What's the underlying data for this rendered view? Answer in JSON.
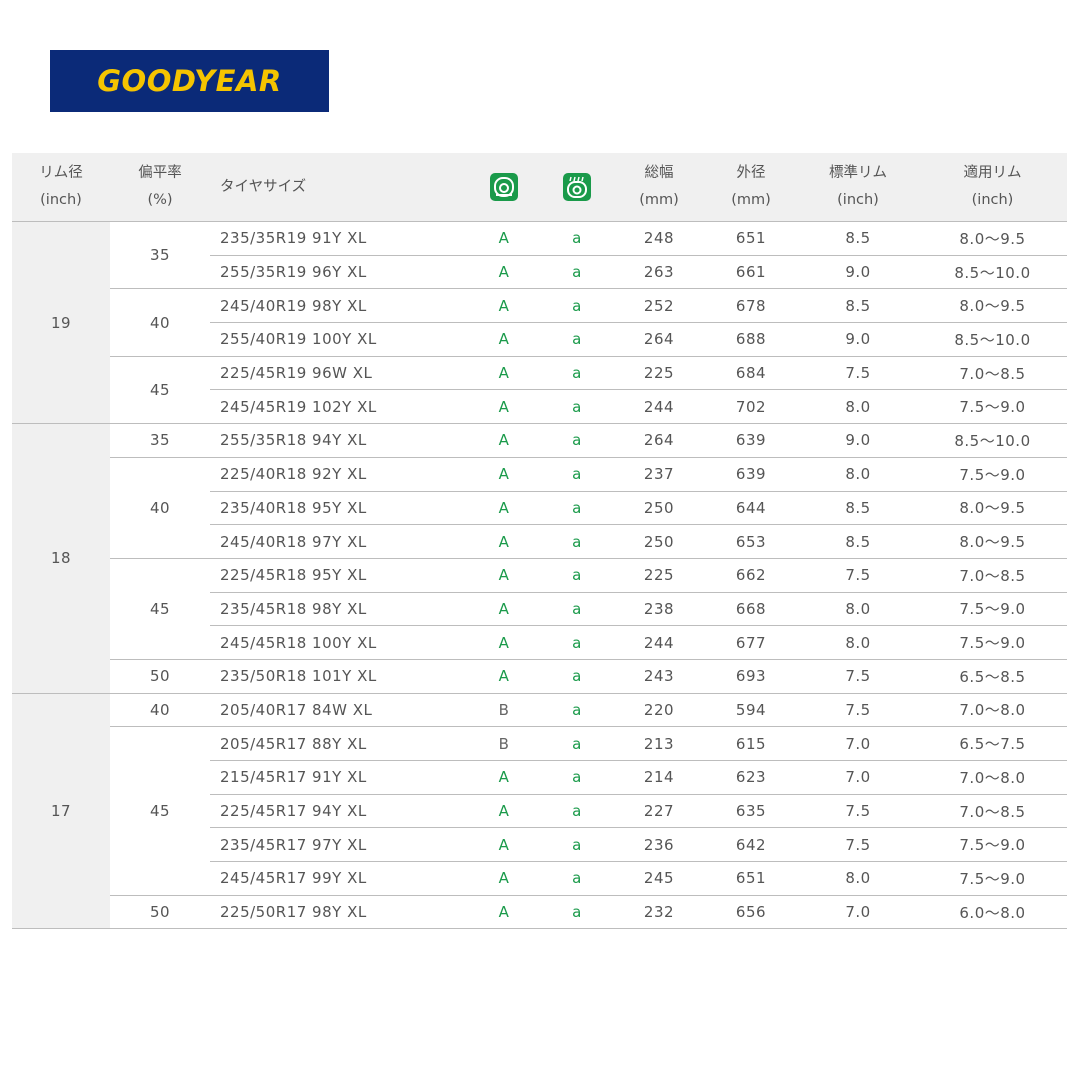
{
  "brand": {
    "logo_text": "GOODYEAR",
    "logo_bg": "#0b2a78",
    "logo_fg": "#f5c400"
  },
  "accent_green": "#1a9a4a",
  "header": {
    "rim_diameter": [
      "リム径",
      "(inch)"
    ],
    "aspect_ratio": [
      "偏平率",
      "(%)"
    ],
    "tire_size": "タイヤサイズ",
    "icon_rolling": "rolling-resistance-icon",
    "icon_wet": "wet-grip-icon",
    "width": [
      "総幅",
      "(mm)"
    ],
    "outer_diameter": [
      "外径",
      "(mm)"
    ],
    "standard_rim": [
      "標準リム",
      "(inch)"
    ],
    "applicable_rim": [
      "適用リム",
      "(inch)"
    ]
  },
  "groups": [
    {
      "rim": "19",
      "subgroups": [
        {
          "ratio": "35",
          "rows": [
            [
              "235/35R19 91Y XL",
              "A",
              "a",
              "248",
              "651",
              "8.5",
              "8.0〜9.5"
            ],
            [
              "255/35R19 96Y XL",
              "A",
              "a",
              "263",
              "661",
              "9.0",
              "8.5〜10.0"
            ]
          ]
        },
        {
          "ratio": "40",
          "rows": [
            [
              "245/40R19 98Y XL",
              "A",
              "a",
              "252",
              "678",
              "8.5",
              "8.0〜9.5"
            ],
            [
              "255/40R19 100Y XL",
              "A",
              "a",
              "264",
              "688",
              "9.0",
              "8.5〜10.0"
            ]
          ]
        },
        {
          "ratio": "45",
          "rows": [
            [
              "225/45R19 96W XL",
              "A",
              "a",
              "225",
              "684",
              "7.5",
              "7.0〜8.5"
            ],
            [
              "245/45R19 102Y XL",
              "A",
              "a",
              "244",
              "702",
              "8.0",
              "7.5〜9.0"
            ]
          ]
        }
      ]
    },
    {
      "rim": "18",
      "subgroups": [
        {
          "ratio": "35",
          "rows": [
            [
              "255/35R18 94Y XL",
              "A",
              "a",
              "264",
              "639",
              "9.0",
              "8.5〜10.0"
            ]
          ]
        },
        {
          "ratio": "40",
          "rows": [
            [
              "225/40R18 92Y XL",
              "A",
              "a",
              "237",
              "639",
              "8.0",
              "7.5〜9.0"
            ],
            [
              "235/40R18 95Y XL",
              "A",
              "a",
              "250",
              "644",
              "8.5",
              "8.0〜9.5"
            ],
            [
              "245/40R18 97Y XL",
              "A",
              "a",
              "250",
              "653",
              "8.5",
              "8.0〜9.5"
            ]
          ]
        },
        {
          "ratio": "45",
          "rows": [
            [
              "225/45R18 95Y XL",
              "A",
              "a",
              "225",
              "662",
              "7.5",
              "7.0〜8.5"
            ],
            [
              "235/45R18 98Y XL",
              "A",
              "a",
              "238",
              "668",
              "8.0",
              "7.5〜9.0"
            ],
            [
              "245/45R18 100Y XL",
              "A",
              "a",
              "244",
              "677",
              "8.0",
              "7.5〜9.0"
            ]
          ]
        },
        {
          "ratio": "50",
          "rows": [
            [
              "235/50R18 101Y XL",
              "A",
              "a",
              "243",
              "693",
              "7.5",
              "6.5〜8.5"
            ]
          ]
        }
      ]
    },
    {
      "rim": "17",
      "subgroups": [
        {
          "ratio": "40",
          "rows": [
            [
              "205/40R17 84W XL",
              "B",
              "a",
              "220",
              "594",
              "7.5",
              "7.0〜8.0"
            ]
          ]
        },
        {
          "ratio": "45",
          "rows": [
            [
              "205/45R17 88Y XL",
              "B",
              "a",
              "213",
              "615",
              "7.0",
              "6.5〜7.5"
            ],
            [
              "215/45R17 91Y XL",
              "A",
              "a",
              "214",
              "623",
              "7.0",
              "7.0〜8.0"
            ],
            [
              "225/45R17 94Y XL",
              "A",
              "a",
              "227",
              "635",
              "7.5",
              "7.0〜8.5"
            ],
            [
              "235/45R17 97Y XL",
              "A",
              "a",
              "236",
              "642",
              "7.5",
              "7.5〜9.0"
            ],
            [
              "245/45R17 99Y XL",
              "A",
              "a",
              "245",
              "651",
              "8.0",
              "7.5〜9.0"
            ]
          ]
        },
        {
          "ratio": "50",
          "rows": [
            [
              "225/50R17 98Y XL",
              "A",
              "a",
              "232",
              "656",
              "7.0",
              "6.0〜8.0"
            ]
          ]
        }
      ]
    }
  ]
}
